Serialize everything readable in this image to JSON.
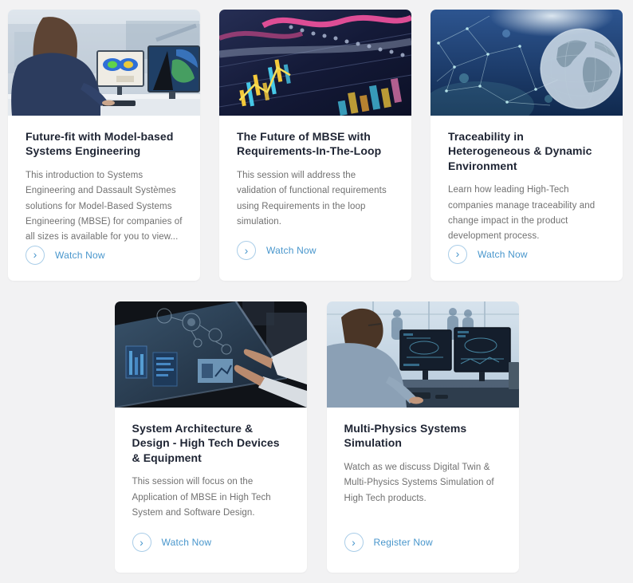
{
  "page": {
    "background_color": "#f2f2f3"
  },
  "colors": {
    "card_background": "#ffffff",
    "title": "#1e2433",
    "description": "#707070",
    "link": "#4896cc",
    "link_circle_border": "#a9cde8"
  },
  "icons": {
    "chevron": "›"
  },
  "cards": [
    {
      "image_desc": "engineer-at-dual-monitor-simulation-workstation",
      "title": "Future-fit with Model-based Systems Engineering",
      "description": "This introduction to Systems Engineering and Dassault Systèmes solutions for Model-Based Systems Engineering (MBSE) for companies of all sizes is available for you to view...",
      "cta": "Watch Now"
    },
    {
      "image_desc": "dark-screen-financial-data-charts",
      "title": "The Future of MBSE with Requirements-In-The-Loop",
      "description": "This session will address the validation of functional requirements using Requirements in the loop simulation.",
      "cta": "Watch Now"
    },
    {
      "image_desc": "digital-globe-with-network-mesh",
      "title": "Traceability in Heterogeneous & Dynamic Environment",
      "description": "Learn how leading High-Tech companies manage traceability and change impact in the product development process.",
      "cta": "Watch Now"
    },
    {
      "image_desc": "hands-on-interactive-touchscreen-dashboard",
      "title": "System Architecture & Design - High Tech Devices & Equipment",
      "description": "This session will focus on the Application of MBSE in High Tech System and Software Design.",
      "cta": "Watch Now"
    },
    {
      "image_desc": "engineer-at-dual-monitors-multiphysics",
      "title": "Multi-Physics Systems Simulation",
      "description": "Watch as we discuss Digital Twin & Multi-Physics Systems Simulation of High Tech products.",
      "cta": "Register Now"
    }
  ]
}
